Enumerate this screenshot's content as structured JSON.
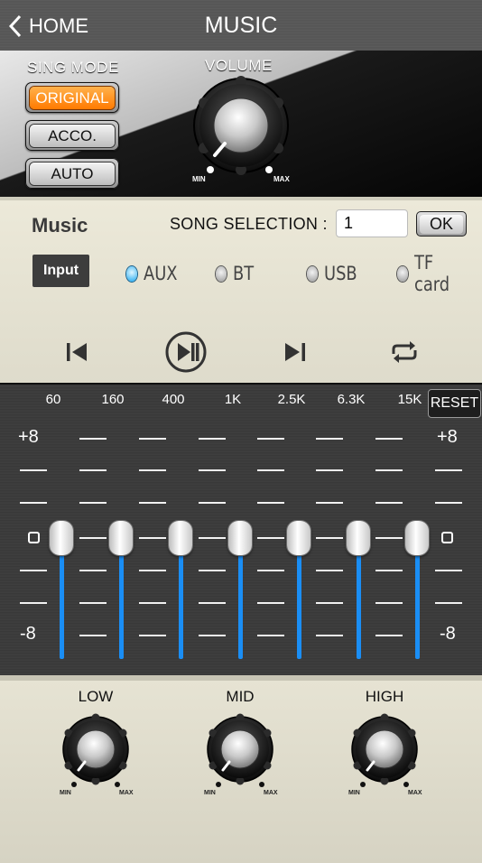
{
  "header": {
    "back_label": "HOME",
    "title": "MUSIC"
  },
  "sing_mode": {
    "label": "SING MODE",
    "options": [
      "ORIGINAL",
      "ACCO.",
      "AUTO"
    ],
    "selected": "ORIGINAL"
  },
  "volume": {
    "label": "VOLUME",
    "min_label": "MIN",
    "max_label": "MAX"
  },
  "music": {
    "title": "Music",
    "song_selection_label": "SONG SELECTION :",
    "song_selection_value": "1",
    "ok_label": "OK"
  },
  "input": {
    "label": "Input",
    "sources": [
      "AUX",
      "BT",
      "USB",
      "TF card"
    ],
    "selected": "AUX"
  },
  "transport": {
    "icons": [
      "previous-icon",
      "play-pause-icon",
      "next-icon",
      "repeat-icon"
    ]
  },
  "eq": {
    "bands": [
      {
        "freq": "60",
        "level": 0
      },
      {
        "freq": "160",
        "level": 0
      },
      {
        "freq": "400",
        "level": 0
      },
      {
        "freq": "1K",
        "level": 0
      },
      {
        "freq": "2.5K",
        "level": 0
      },
      {
        "freq": "6.3K",
        "level": 0
      },
      {
        "freq": "15K",
        "level": 0
      }
    ],
    "reset_label": "RESET",
    "scale": {
      "top": "+8",
      "mid": "0",
      "bottom": "-8"
    },
    "accent_color": "#1a8ef5"
  },
  "tone": {
    "labels": [
      "LOW",
      "MID",
      "HIGH"
    ],
    "min_label": "MIN",
    "max_label": "MAX"
  },
  "colors": {
    "active_mode": "#ff8a00",
    "selected_radio": "#19a6f0"
  }
}
